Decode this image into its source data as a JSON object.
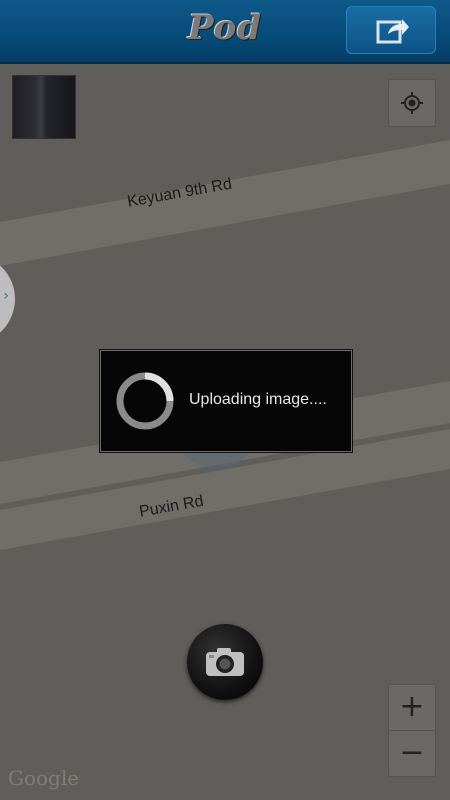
{
  "app": {
    "title": "Pod"
  },
  "header": {
    "share_icon": "share-icon"
  },
  "map": {
    "roads": [
      "Keyuan 9th Rd",
      "Puxin Rd"
    ],
    "locate_icon": "locate-icon",
    "zoom_in_label": "+",
    "zoom_out_label": "−",
    "attribution": "Google"
  },
  "dialog": {
    "message": "Uploading image...."
  },
  "camera": {
    "icon": "camera-icon"
  },
  "colors": {
    "header": "#064a78",
    "map_bg": "#5f5e5a",
    "dialog_bg": "#060606"
  }
}
